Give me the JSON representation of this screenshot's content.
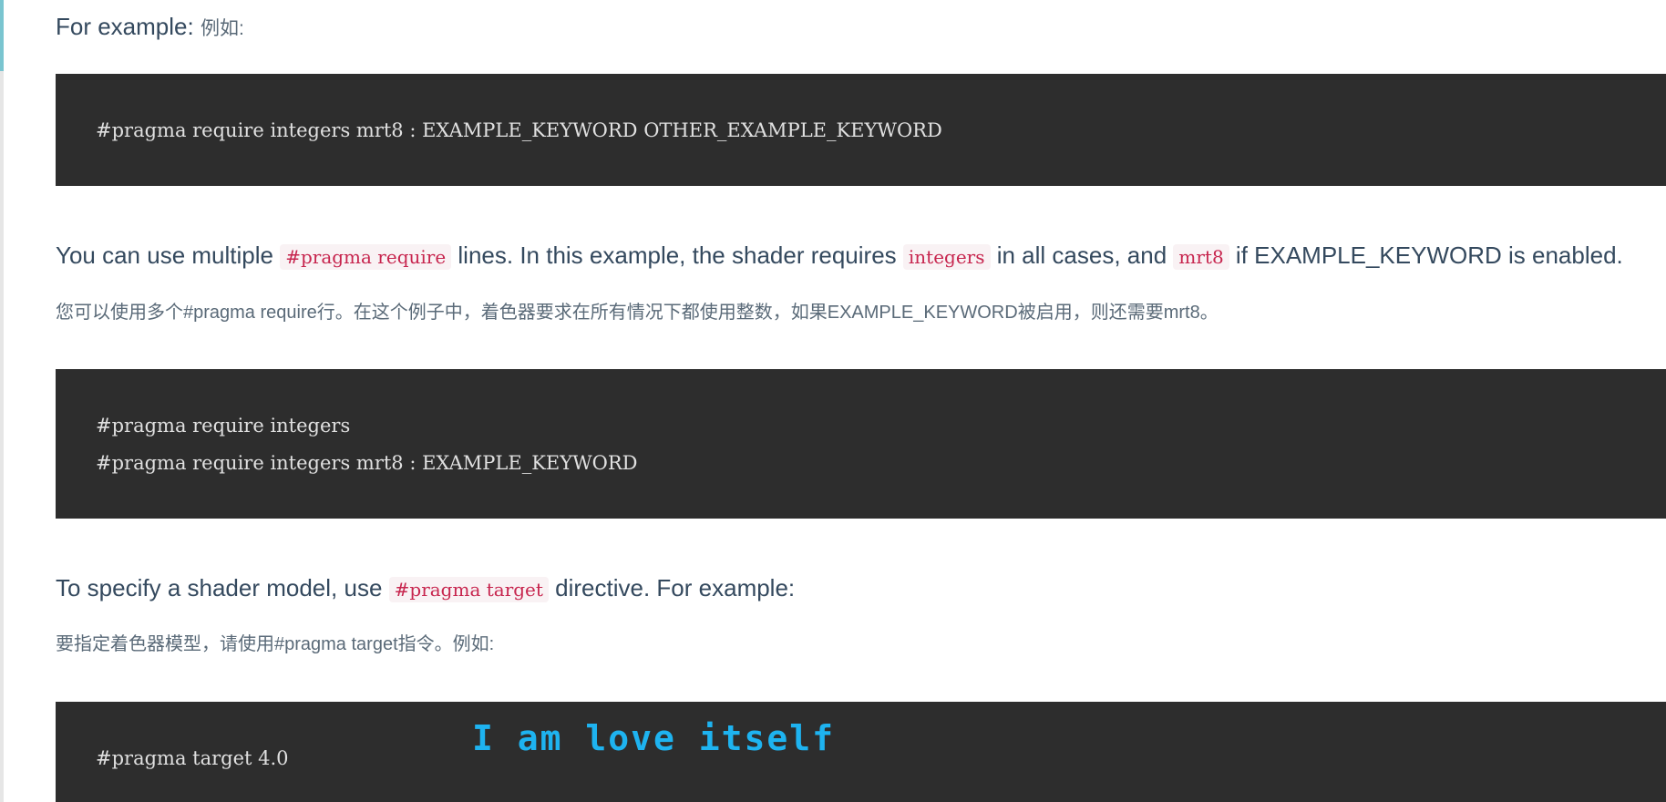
{
  "intro": {
    "en": "For example:",
    "zh": "例如:"
  },
  "code_block_1": {
    "lines": [
      "#pragma require integers mrt8 : EXAMPLE_KEYWORD OTHER_EXAMPLE_KEYWORD"
    ]
  },
  "para_multiple": {
    "t1": "You can use multiple ",
    "c1": "#pragma require",
    "t2": " lines. In this example, the shader requires ",
    "c2": "integers",
    "t3": " in all cases, and ",
    "c3": "mrt8",
    "t4": " if EXAMPLE_KEYWORD is enabled.",
    "zh": "您可以使用多个#pragma require行。在这个例子中，着色器要求在所有情况下都使用整数，如果EXAMPLE_KEYWORD被启用，则还需要mrt8。"
  },
  "code_block_2": {
    "lines": [
      "#pragma require integers",
      "#pragma require integers mrt8 : EXAMPLE_KEYWORD"
    ]
  },
  "para_target": {
    "t1": "To specify a shader model, use ",
    "c1": "#pragma target",
    "t2": " directive. For example:",
    "zh": "要指定着色器模型，请使用#pragma target指令。例如:"
  },
  "code_block_3": {
    "lines": [
      "#pragma target 4.0"
    ]
  },
  "overlay": {
    "text": "I am love itself"
  },
  "colors": {
    "code_bg": "#2d2d2d",
    "inline_code_fg": "#c7254e",
    "inline_code_bg": "#f9f2f4",
    "overlay_text": "#1eb3f0",
    "accent_rail": "#7ac5d0"
  }
}
